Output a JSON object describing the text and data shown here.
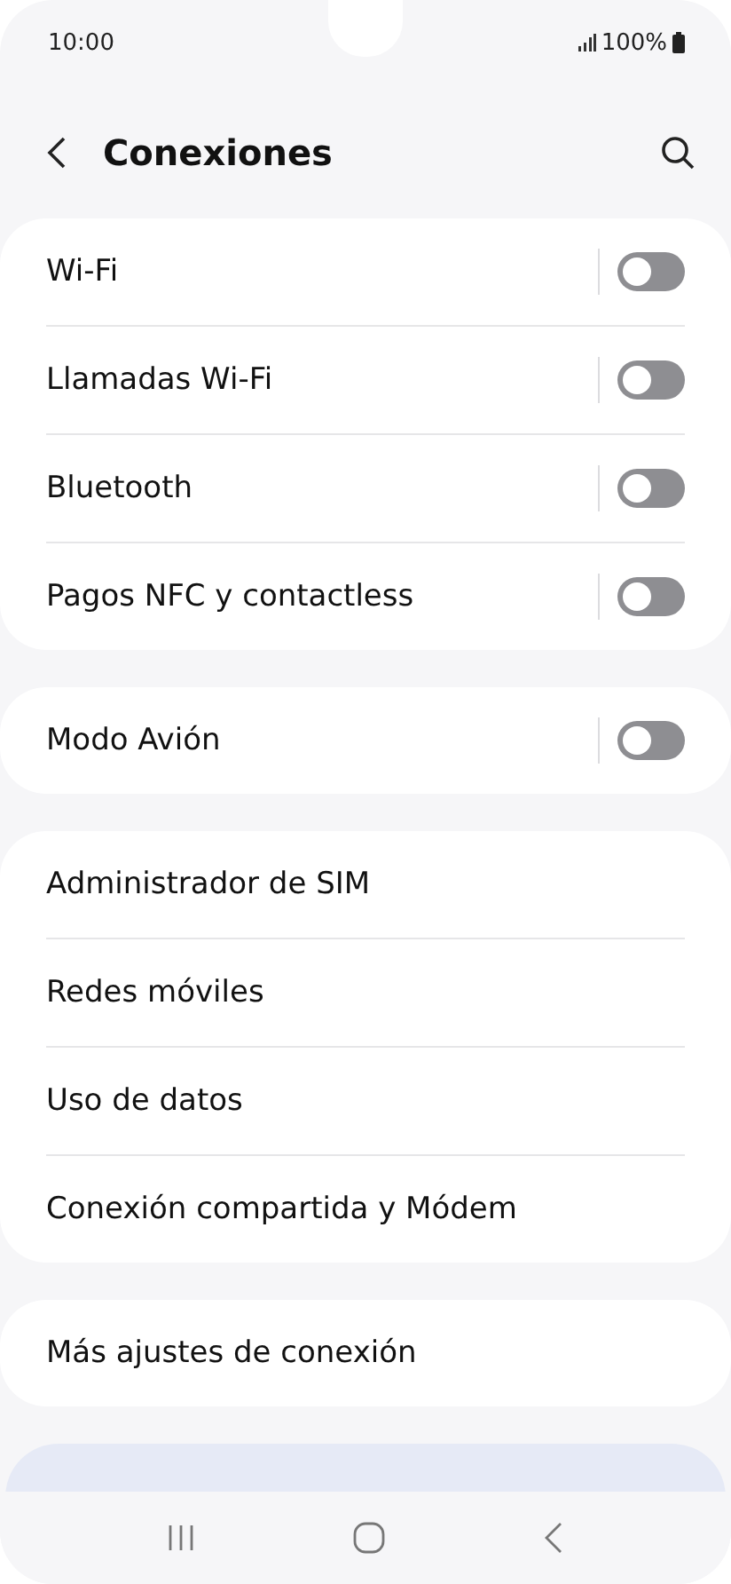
{
  "status_bar": {
    "time": "10:00",
    "battery": "100%"
  },
  "header": {
    "title": "Conexiones"
  },
  "groups": [
    {
      "items": [
        {
          "label": "Wi-Fi",
          "kind": "toggle",
          "on": false
        },
        {
          "label": "Llamadas Wi-Fi",
          "kind": "toggle",
          "on": false
        },
        {
          "label": "Bluetooth",
          "kind": "toggle",
          "on": false
        },
        {
          "label": "Pagos NFC y contactless",
          "kind": "toggle",
          "on": false
        }
      ]
    },
    {
      "items": [
        {
          "label": "Modo Avión",
          "kind": "toggle",
          "on": false
        }
      ]
    },
    {
      "items": [
        {
          "label": "Administrador de SIM",
          "kind": "link"
        },
        {
          "label": "Redes móviles",
          "kind": "link"
        },
        {
          "label": "Uso de datos",
          "kind": "link"
        },
        {
          "label": "Conexión compartida y Módem",
          "kind": "link"
        }
      ]
    },
    {
      "items": [
        {
          "label": "Más ajustes de conexión",
          "kind": "link"
        }
      ]
    }
  ]
}
